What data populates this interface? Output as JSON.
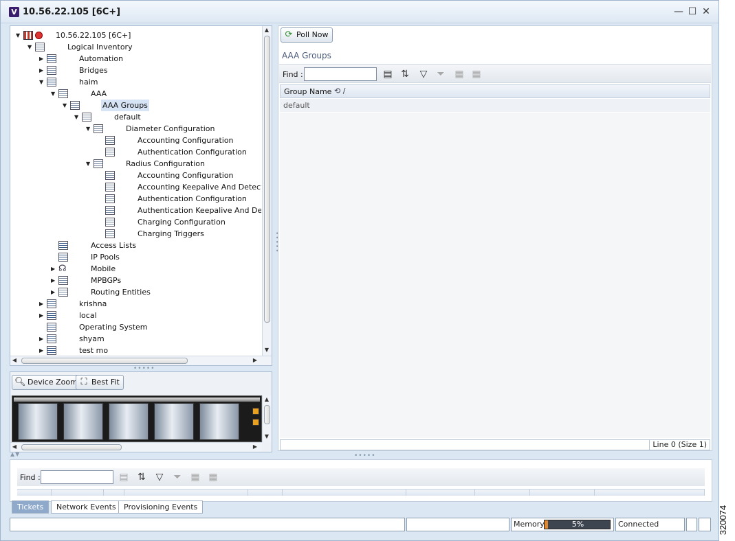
{
  "window": {
    "title": "10.56.22.105 [6C+]",
    "logo": "V",
    "controls": {
      "minimize": "—",
      "maximize": "☐",
      "close": "✕"
    }
  },
  "tree": {
    "root": "10.56.22.105 [6C+]",
    "logical_inventory": "Logical Inventory",
    "automation": "Automation",
    "bridges": "Bridges",
    "haim": "haim",
    "aaa": "AAA",
    "aaa_groups": "AAA Groups",
    "default": "default",
    "diameter_config": "Diameter Configuration",
    "diameter_accounting": "Accounting Configuration",
    "diameter_authentication": "Authentication Configuration",
    "radius_config": "Radius Configuration",
    "radius_accounting": "Accounting Configuration",
    "radius_acct_keepalive": "Accounting Keepalive And Detect Dea",
    "radius_authentication": "Authentication Configuration",
    "radius_auth_keepalive": "Authentication Keepalive And Detect",
    "radius_charging": "Charging Configuration",
    "radius_charging_triggers": "Charging Triggers",
    "access_lists": "Access Lists",
    "ip_pools": "IP Pools",
    "mobile": "Mobile",
    "mpbgps": "MPBGPs",
    "routing_entities": "Routing Entities",
    "krishna": "krishna",
    "local": "local",
    "operating_system": "Operating System",
    "shyam": "shyam",
    "test_mo": "test mo"
  },
  "device_view": {
    "device_zoom": "Device Zoom",
    "best_fit": "Best Fit"
  },
  "content": {
    "poll_now": "Poll Now",
    "section_title": "AAA Groups",
    "find_label": "Find :",
    "find_value": "",
    "column_group_name": "Group Name",
    "rows": [
      "default"
    ],
    "line_status": "Line 0 (Size 1)"
  },
  "bottom": {
    "find_label": "Find :",
    "find_value": "",
    "tabs": [
      "Tickets",
      "Network Events",
      "Provisioning Events"
    ]
  },
  "statusbar": {
    "memory_label": "Memory:",
    "memory_percent": "5%",
    "memory_fraction": 0.05,
    "connection": "Connected"
  },
  "figure_id": "320074",
  "colors": {
    "window_bg": "#dbe7f3",
    "selection": "#d7e4f5",
    "memory_fill": "#e08a30",
    "active_tab": "#8ea9c9"
  }
}
